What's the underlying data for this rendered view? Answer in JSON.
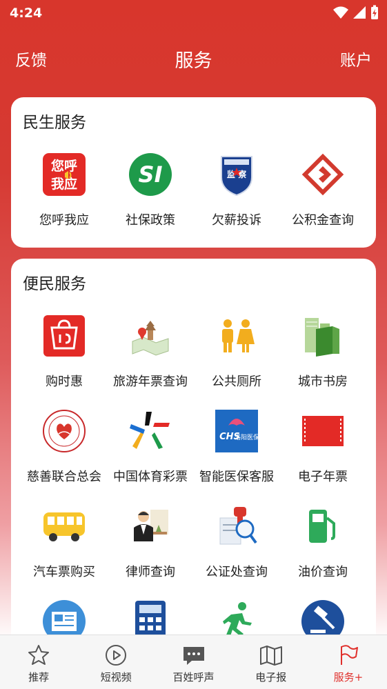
{
  "status_bar": {
    "time": "4:24"
  },
  "header": {
    "left": "反馈",
    "title": "服务",
    "right": "账户"
  },
  "section1": {
    "title": "民生服务",
    "items": [
      {
        "label": "您呼我应",
        "icon": "ninhu-woying-icon",
        "icon_text_1": "您呼",
        "icon_text_2": "我应"
      },
      {
        "label": "社保政策",
        "icon": "social-security-si-icon",
        "icon_text": "SI"
      },
      {
        "label": "欠薪投诉",
        "icon": "labor-supervision-badge-icon",
        "icon_text": "监 察"
      },
      {
        "label": "公积金查询",
        "icon": "housing-fund-logo-icon"
      }
    ]
  },
  "section2": {
    "title": "便民服务",
    "items": [
      {
        "label": "购时惠",
        "icon": "shopping-bag-icon"
      },
      {
        "label": "旅游年票查询",
        "icon": "travel-map-pin-icon"
      },
      {
        "label": "公共厕所",
        "icon": "public-toilet-icon"
      },
      {
        "label": "城市书房",
        "icon": "city-library-icon"
      },
      {
        "label": "慈善联合总会",
        "icon": "charity-federation-seal-icon"
      },
      {
        "label": "中国体育彩票",
        "icon": "sports-lottery-star-icon"
      },
      {
        "label": "智能医保客服",
        "icon": "medical-insurance-chs-icon",
        "icon_text_1": "CHS",
        "icon_text_2": "洛阳医保"
      },
      {
        "label": "电子年票",
        "icon": "e-ticket-icon"
      },
      {
        "label": "汽车票购买",
        "icon": "bus-icon"
      },
      {
        "label": "律师查询",
        "icon": "lawyer-icon"
      },
      {
        "label": "公证处查询",
        "icon": "notary-stamp-icon"
      },
      {
        "label": "油价查询",
        "icon": "fuel-pump-icon"
      },
      {
        "label": "",
        "icon": "newspaper-icon"
      },
      {
        "label": "",
        "icon": "calculator-icon"
      },
      {
        "label": "",
        "icon": "running-man-icon"
      },
      {
        "label": "",
        "icon": "gavel-icon"
      }
    ]
  },
  "bottom_nav": [
    {
      "label": "推荐",
      "icon": "star-icon"
    },
    {
      "label": "短视频",
      "icon": "play-circle-icon"
    },
    {
      "label": "百姓呼声",
      "icon": "chat-bubble-icon"
    },
    {
      "label": "电子报",
      "icon": "map-paper-icon"
    },
    {
      "label": "服务+",
      "icon": "flag-icon",
      "active": true
    }
  ],
  "colors": {
    "primary": "#d8362c",
    "active_nav": "#e0302c"
  }
}
